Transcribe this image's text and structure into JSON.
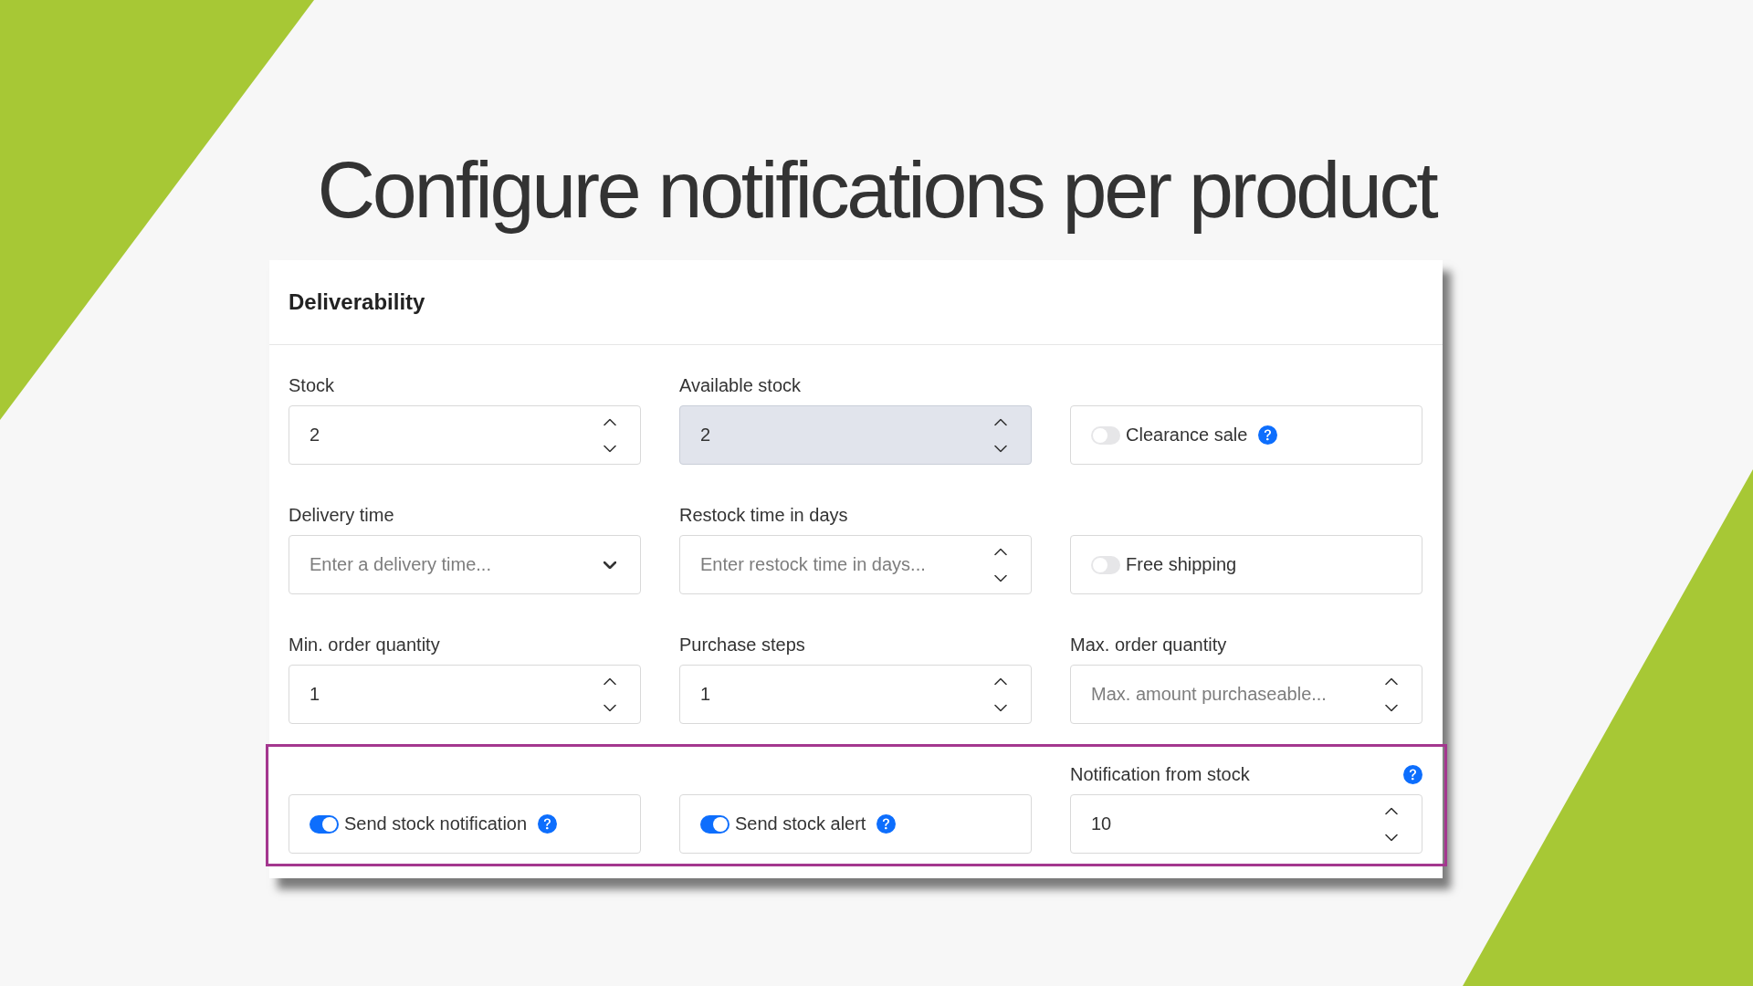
{
  "slide": {
    "title": "Configure notifications per product"
  },
  "panel": {
    "title": "Deliverability",
    "rows": [
      {
        "highlighted": false,
        "fields": [
          {
            "kind": "number",
            "label": "Stock",
            "value": "2",
            "disabled": false
          },
          {
            "kind": "number",
            "label": "Available stock",
            "value": "2",
            "disabled": true
          },
          {
            "kind": "toggle",
            "text": "Clearance sale",
            "on": false,
            "help": true
          }
        ]
      },
      {
        "highlighted": false,
        "fields": [
          {
            "kind": "select",
            "label": "Delivery time",
            "placeholder": "Enter a delivery time..."
          },
          {
            "kind": "number",
            "label": "Restock time in days",
            "placeholder": "Enter restock time in days...",
            "disabled": false
          },
          {
            "kind": "toggle",
            "text": "Free shipping",
            "on": false,
            "help": false
          }
        ]
      },
      {
        "highlighted": false,
        "fields": [
          {
            "kind": "number",
            "label": "Min. order quantity",
            "value": "1",
            "disabled": false
          },
          {
            "kind": "number",
            "label": "Purchase steps",
            "value": "1",
            "disabled": false
          },
          {
            "kind": "number",
            "label": "Max. order quantity",
            "placeholder": "Max. amount purchaseable...",
            "disabled": false
          }
        ]
      },
      {
        "highlighted": true,
        "fields": [
          {
            "kind": "toggle",
            "text": "Send stock notification",
            "on": true,
            "help": true
          },
          {
            "kind": "toggle",
            "text": "Send stock alert",
            "on": true,
            "help": true
          },
          {
            "kind": "number",
            "label": "Notification from stock",
            "label_help": true,
            "value": "10",
            "disabled": false
          }
        ]
      }
    ]
  }
}
